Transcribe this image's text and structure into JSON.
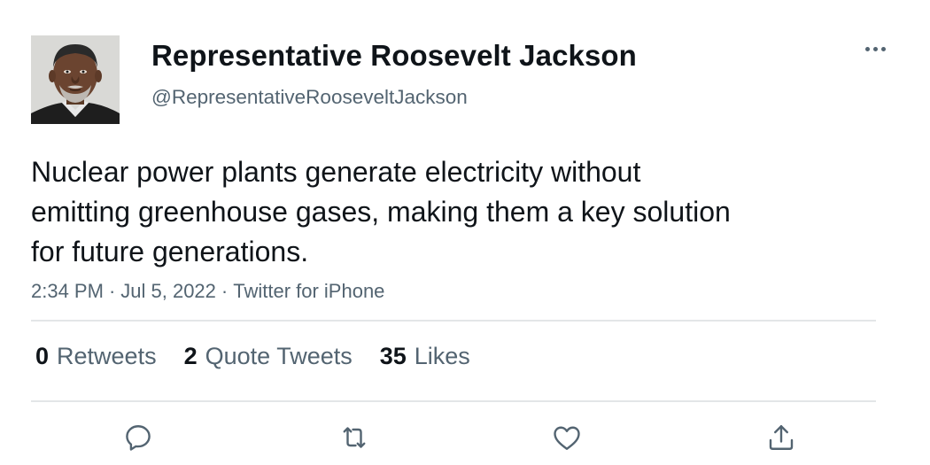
{
  "author": {
    "display_name": "Representative Roosevelt Jackson",
    "handle": "@RepresentativeRooseveltJackson",
    "avatar_icon": "profile-photo"
  },
  "tweet": {
    "text": "Nuclear power plants generate electricity without\nemitting greenhouse gases, making them a key solution\nfor future generations.",
    "time": "2:34 PM",
    "separator": "·",
    "date": "Jul 5, 2022",
    "source": "Twitter for iPhone"
  },
  "stats": {
    "retweets": {
      "count": "0",
      "label": "Retweets"
    },
    "quote_tweets": {
      "count": "2",
      "label": "Quote Tweets"
    },
    "likes": {
      "count": "35",
      "label": "Likes"
    }
  },
  "actions": [
    {
      "name": "reply",
      "icon": "reply-icon"
    },
    {
      "name": "retweet",
      "icon": "retweet-icon"
    },
    {
      "name": "like",
      "icon": "heart-icon"
    },
    {
      "name": "share",
      "icon": "share-icon"
    }
  ],
  "colors": {
    "text_primary": "#0f1419",
    "text_secondary": "#536471",
    "divider": "#e3e6e8"
  }
}
